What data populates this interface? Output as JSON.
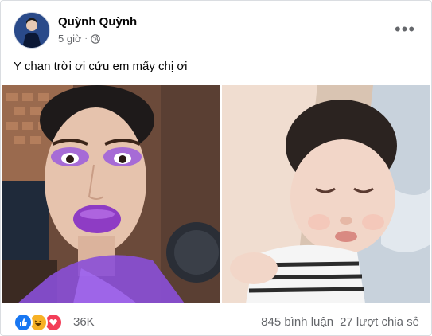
{
  "post": {
    "author": "Quỳnh Quỳnh",
    "time": "5 giờ",
    "meta_separator": "·",
    "privacy_icon": "globe-icon",
    "caption": "Y chan trời ơi cứu em mấy chị ơi",
    "more_icon": "more-options-icon",
    "more_label": "•••"
  },
  "footer": {
    "reaction_icons": [
      "like-icon",
      "haha-icon",
      "love-icon"
    ],
    "reaction_count": "36K",
    "comments": "845 bình luận",
    "shares": "27 lượt chia sẻ"
  },
  "colors": {
    "like": "#1877f2",
    "haha": "#f7b125",
    "love": "#f33e58",
    "secondary_text": "#65676b"
  }
}
